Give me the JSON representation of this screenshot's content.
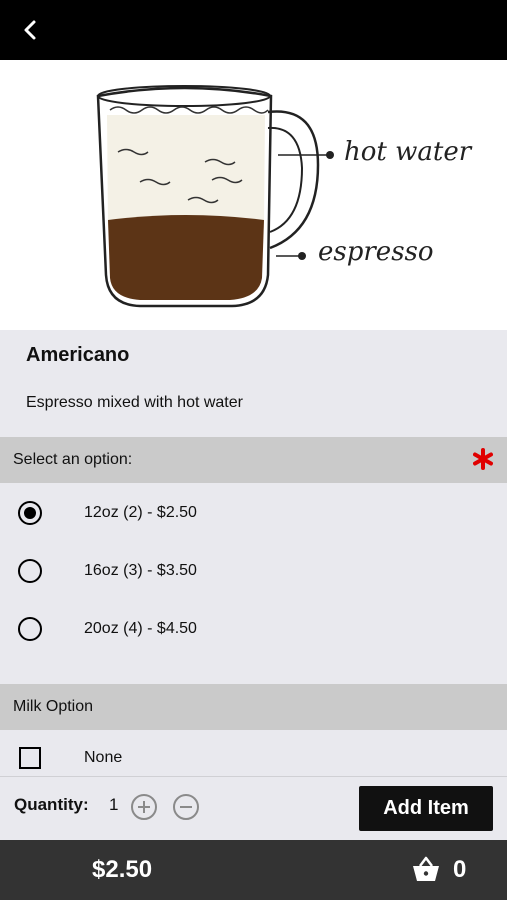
{
  "header": {
    "back_icon": "chevron-left-icon"
  },
  "hero": {
    "label_top": "hot water",
    "label_bottom": "espresso"
  },
  "item": {
    "name": "Americano",
    "description": "Espresso mixed with hot water"
  },
  "size_section": {
    "title": "Select an option:",
    "required_color": "#e00000",
    "options": [
      {
        "label": "12oz (2) - $2.50",
        "selected": true
      },
      {
        "label": "16oz (3) - $3.50",
        "selected": false
      },
      {
        "label": "20oz (4) - $4.50",
        "selected": false
      }
    ]
  },
  "milk_section": {
    "title": "Milk Option",
    "options": [
      {
        "label": "None",
        "checked": false
      }
    ]
  },
  "quantity": {
    "label": "Quantity:",
    "value": "1",
    "add_button": "Add Item"
  },
  "footer": {
    "total": "$2.50",
    "cart_count": "0"
  }
}
